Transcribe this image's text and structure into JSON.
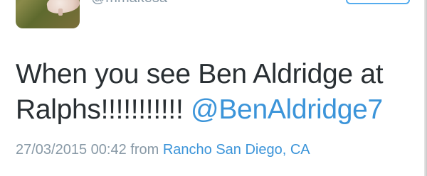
{
  "tweet": {
    "handle": "@mmakesa",
    "text_line1": "When you see Ben Aldridge at",
    "text_line2_start": "Ralphs!!!!!!!!!!!",
    "mention": "@BenAldridge7",
    "timestamp": "27/03/2015 00:42",
    "from_word": "from",
    "location": "Rancho San Diego, CA"
  },
  "colors": {
    "text": "#292f33",
    "muted": "#8899a6",
    "link": "#3b94d9",
    "follow_border": "#55acee"
  }
}
